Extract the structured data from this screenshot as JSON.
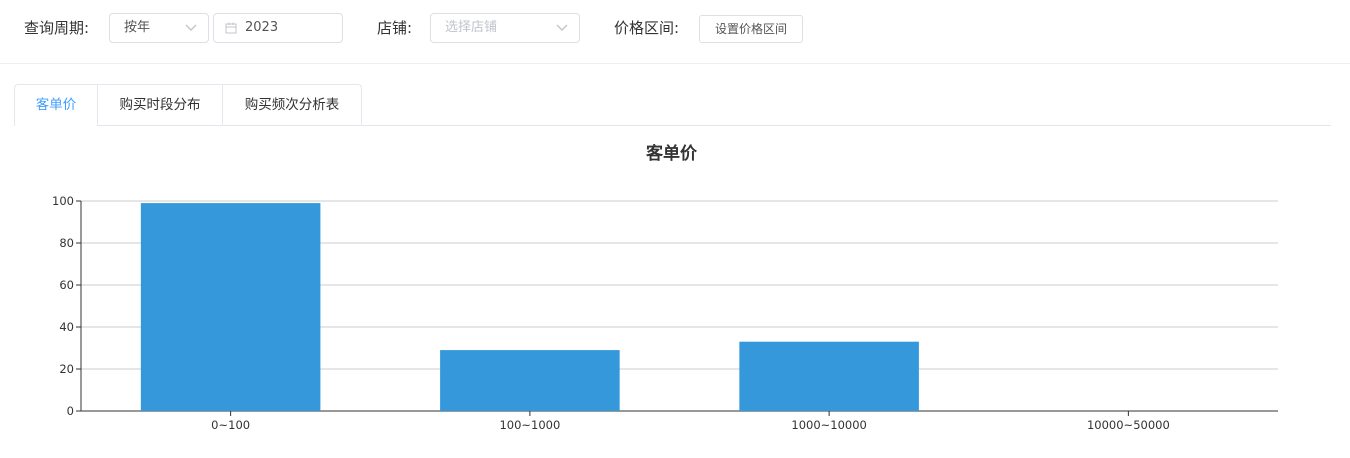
{
  "filters": {
    "period_label": "查询周期:",
    "period_select": "按年",
    "date_value": "2023",
    "store_label": "店铺:",
    "store_placeholder": "选择店铺",
    "price_label": "价格区间:",
    "price_button": "设置价格区间"
  },
  "tabs": [
    {
      "label": "客单价",
      "active": true
    },
    {
      "label": "购买时段分布",
      "active": false
    },
    {
      "label": "购买频次分析表",
      "active": false
    }
  ],
  "colors": {
    "bar": "#3498db",
    "accent": "#409eff"
  },
  "chart_data": {
    "type": "bar",
    "title": "客单价",
    "categories": [
      "0~100",
      "100~1000",
      "1000~10000",
      "10000~50000"
    ],
    "values": [
      99,
      29,
      33,
      0
    ],
    "ylim": [
      0,
      100
    ],
    "yticks": [
      0,
      20,
      40,
      60,
      80,
      100
    ],
    "grid": true,
    "xlabel": "",
    "ylabel": ""
  }
}
